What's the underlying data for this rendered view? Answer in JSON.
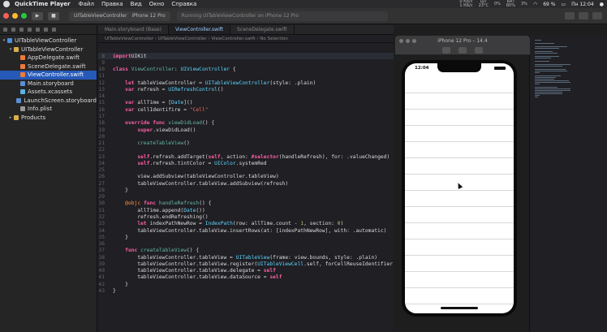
{
  "menubar": {
    "app_name": "QuickTime Player",
    "items": [
      "Файл",
      "Правка",
      "Вид",
      "Окно",
      "Справка"
    ],
    "status_top": [
      "0 КБ/с",
      "1 КБ/с",
      "БАТ",
      "ЦП"
    ],
    "status_bottom": [
      "23°C",
      "0%",
      "80%",
      "3%"
    ],
    "battery": "69 %",
    "clock": "Пн 12:04"
  },
  "toolbar": {
    "scheme_name": "UITableViewController",
    "device_name": "iPhone 12 Pro",
    "status_text": "Running UITableViewController on iPhone 12 Pro"
  },
  "navigator": {
    "items": [
      {
        "label": "UITableViewController",
        "icon": "project-icon",
        "level": 0,
        "disclosure": "▾",
        "selected": false
      },
      {
        "label": "UITableViewController",
        "icon": "folder-icon",
        "level": 1,
        "disclosure": "▾",
        "selected": false
      },
      {
        "label": "AppDelegate.swift",
        "icon": "swift-file-icon",
        "level": 2,
        "disclosure": "",
        "selected": false
      },
      {
        "label": "SceneDelegate.swift",
        "icon": "swift-file-icon",
        "level": 2,
        "disclosure": "",
        "selected": false
      },
      {
        "label": "ViewController.swift",
        "icon": "swift-file-icon",
        "level": 2,
        "disclosure": "",
        "selected": true
      },
      {
        "label": "Main.storyboard",
        "icon": "storyboard-icon",
        "level": 2,
        "disclosure": "",
        "selected": false
      },
      {
        "label": "Assets.xcassets",
        "icon": "assets-icon",
        "level": 2,
        "disclosure": "",
        "selected": false
      },
      {
        "label": "LaunchScreen.storyboard",
        "icon": "storyboard-icon",
        "level": 2,
        "disclosure": "",
        "selected": false
      },
      {
        "label": "Info.plist",
        "icon": "plist-icon",
        "level": 2,
        "disclosure": "",
        "selected": false
      },
      {
        "label": "Products",
        "icon": "folder-icon",
        "level": 1,
        "disclosure": "▸",
        "selected": false
      }
    ]
  },
  "editor": {
    "tabs": [
      {
        "label": "Main.storyboard (Base)",
        "active": false
      },
      {
        "label": "ViewController.swift",
        "active": true
      },
      {
        "label": "SceneDelegate.swift",
        "active": false
      }
    ],
    "jump_bar": "UITableViewController  ›  UITableViewController  ›  ViewController.swift  ›  No Selection",
    "code_lines": [
      {
        "n": "8",
        "t": [
          [
            "kw",
            "import"
          ],
          [
            "",
            "UIKit"
          ]
        ]
      },
      {
        "n": "9",
        "t": []
      },
      {
        "n": "10",
        "t": [
          [
            "kw",
            "class"
          ],
          [
            "",
            " "
          ],
          [
            "fn",
            "ViewController"
          ],
          [
            "",
            ": "
          ],
          [
            "ty",
            "UIViewController"
          ],
          [
            "",
            " {"
          ]
        ]
      },
      {
        "n": "11",
        "t": []
      },
      {
        "n": "12",
        "t": [
          [
            "",
            "    "
          ],
          [
            "kw",
            "let"
          ],
          [
            "",
            " tableViewController = "
          ],
          [
            "ty",
            "UITableViewController"
          ],
          [
            "",
            "(style: .plain)"
          ]
        ]
      },
      {
        "n": "13",
        "t": [
          [
            "",
            "    "
          ],
          [
            "kw",
            "var"
          ],
          [
            "",
            " refresh = "
          ],
          [
            "ty",
            "UIRefreshControl"
          ],
          [
            "",
            "()"
          ]
        ]
      },
      {
        "n": "14",
        "t": []
      },
      {
        "n": "15",
        "t": [
          [
            "",
            "    "
          ],
          [
            "kw",
            "var"
          ],
          [
            "",
            " allTime = ["
          ],
          [
            "ty",
            "Date"
          ],
          [
            "",
            "]()"
          ]
        ]
      },
      {
        "n": "16",
        "t": [
          [
            "",
            "    "
          ],
          [
            "kw",
            "var"
          ],
          [
            "",
            " cellIdentifire = "
          ],
          [
            "str",
            "\"Cell\""
          ]
        ]
      },
      {
        "n": "17",
        "t": []
      },
      {
        "n": "18",
        "t": [
          [
            "",
            "    "
          ],
          [
            "kw",
            "override func"
          ],
          [
            "",
            " "
          ],
          [
            "fn",
            "viewDidLoad"
          ],
          [
            "",
            "() {"
          ]
        ]
      },
      {
        "n": "19",
        "t": [
          [
            "",
            "        "
          ],
          [
            "kw",
            "super"
          ],
          [
            "",
            ".viewDidLoad()"
          ]
        ]
      },
      {
        "n": "20",
        "t": []
      },
      {
        "n": "21",
        "t": [
          [
            "",
            "        "
          ],
          [
            "fn",
            "createTableView"
          ],
          [
            "",
            "()"
          ]
        ]
      },
      {
        "n": "22",
        "t": []
      },
      {
        "n": "23",
        "t": [
          [
            "",
            "        "
          ],
          [
            "kw",
            "self"
          ],
          [
            "",
            ".refresh.addTarget("
          ],
          [
            "kw",
            "self"
          ],
          [
            "",
            ", action: "
          ],
          [
            "kw",
            "#selector"
          ],
          [
            "",
            "(handleRefresh), for: .valueChanged)"
          ]
        ]
      },
      {
        "n": "24",
        "t": [
          [
            "",
            "        "
          ],
          [
            "kw",
            "self"
          ],
          [
            "",
            ".refresh.tintColor = "
          ],
          [
            "ty",
            "UIColor"
          ],
          [
            "",
            ".systemRed"
          ]
        ]
      },
      {
        "n": "25",
        "t": []
      },
      {
        "n": "26",
        "t": [
          [
            "",
            "        "
          ],
          [
            "",
            "view.addSubview(tableViewController.tableView)"
          ]
        ]
      },
      {
        "n": "27",
        "t": [
          [
            "",
            "        "
          ],
          [
            "",
            "tableViewController.tableView.addSubview(refresh)"
          ]
        ]
      },
      {
        "n": "28",
        "t": [
          [
            "",
            "    }"
          ]
        ]
      },
      {
        "n": "29",
        "t": []
      },
      {
        "n": "30",
        "t": [
          [
            "",
            "    "
          ],
          [
            "attr",
            "@objc"
          ],
          [
            "",
            " "
          ],
          [
            "kw",
            "func"
          ],
          [
            "",
            " "
          ],
          [
            "fn",
            "handleRefresh"
          ],
          [
            "",
            "() {"
          ]
        ]
      },
      {
        "n": "31",
        "t": [
          [
            "",
            "        allTime.append("
          ],
          [
            "ty",
            "Date"
          ],
          [
            "",
            "())"
          ]
        ]
      },
      {
        "n": "32",
        "t": [
          [
            "",
            "        refresh.endRefreshing()"
          ]
        ]
      },
      {
        "n": "33",
        "t": [
          [
            "",
            "        "
          ],
          [
            "kw",
            "let"
          ],
          [
            "",
            " indexPathNewRow = "
          ],
          [
            "ty",
            "IndexPath"
          ],
          [
            "",
            "(row: allTime.count - "
          ],
          [
            "num2",
            "1"
          ],
          [
            "",
            ", section: "
          ],
          [
            "num2",
            "0"
          ],
          [
            "",
            ")"
          ]
        ]
      },
      {
        "n": "34",
        "t": [
          [
            "",
            "        tableViewController.tableView.insertRows(at: [indexPathNewRow], with: .automatic)"
          ]
        ]
      },
      {
        "n": "35",
        "t": [
          [
            "",
            "    }"
          ]
        ]
      },
      {
        "n": "36",
        "t": []
      },
      {
        "n": "37",
        "t": [
          [
            "",
            "    "
          ],
          [
            "kw",
            "func"
          ],
          [
            "",
            " "
          ],
          [
            "fn",
            "createTableView"
          ],
          [
            "",
            "() {"
          ]
        ]
      },
      {
        "n": "38",
        "t": [
          [
            "",
            "        tableViewController.tableView = "
          ],
          [
            "ty",
            "UITableView"
          ],
          [
            "",
            "(frame: view.bounds, style: .plain)"
          ]
        ]
      },
      {
        "n": "39",
        "t": [
          [
            "",
            "        tableViewController.tableView.register("
          ],
          [
            "ty",
            "UITableViewCell"
          ],
          [
            "",
            ".self, forCellReuseIdentifier: cellIdentifire)"
          ]
        ]
      },
      {
        "n": "40",
        "t": [
          [
            "",
            "        tableViewController.tableView.delegate = "
          ],
          [
            "kw",
            "self"
          ]
        ]
      },
      {
        "n": "41",
        "t": [
          [
            "",
            "        tableViewController.tableView.dataSource = "
          ],
          [
            "kw",
            "self"
          ]
        ]
      },
      {
        "n": "42",
        "t": [
          [
            "",
            "    }"
          ]
        ]
      },
      {
        "n": "43",
        "t": [
          [
            "",
            "}"
          ]
        ]
      }
    ]
  },
  "simulator": {
    "title": "iPhone 12 Pro – 14.4",
    "status_time": "12:04",
    "row_count": 14
  }
}
